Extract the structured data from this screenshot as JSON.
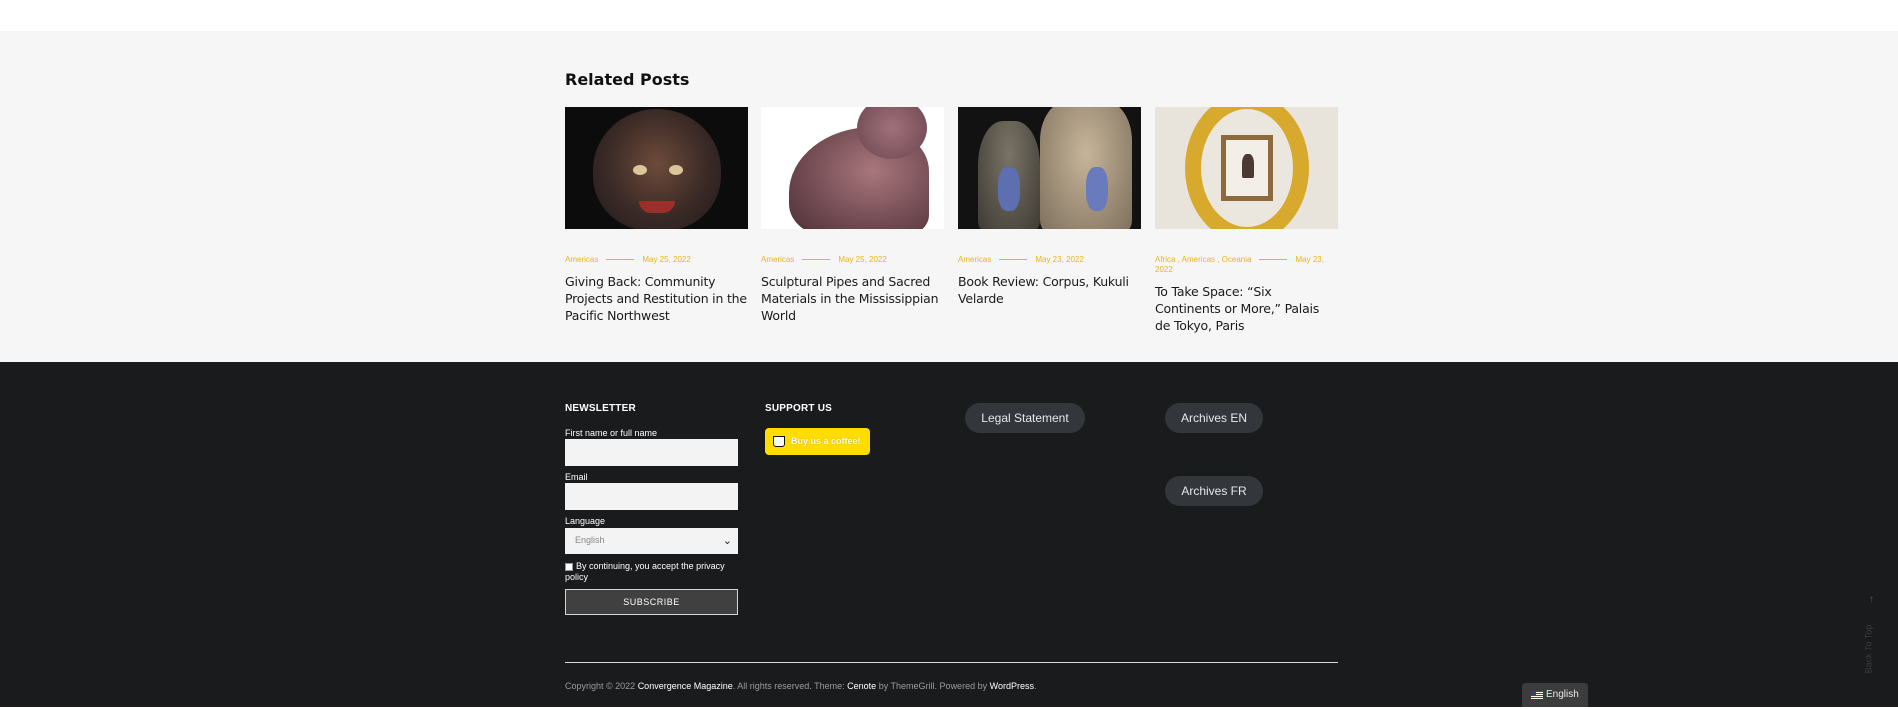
{
  "related": {
    "title": "Related Posts",
    "posts": [
      {
        "meta_categories": "Americas",
        "date": "May 25, 2022",
        "title": "Giving Back: Community Projects and Restitution in the Pacific Northwest",
        "image_icon": "mask-image"
      },
      {
        "meta_categories": "Americas",
        "date": "May 25, 2022",
        "title": "Sculptural Pipes and Sacred Materials in the Mississippian World",
        "image_icon": "sculpture-image"
      },
      {
        "meta_categories": "Americas",
        "date": "May 23, 2022",
        "title": "Book Review: Corpus, Kukuli Velarde",
        "image_icon": "figures-image"
      },
      {
        "meta_categories": "Africa , Americas , Oceania",
        "date": "May 23, 2022",
        "title": "To Take Space: “Six Continents or More,” Palais de Tokyo, Paris",
        "image_icon": "frame-image"
      }
    ]
  },
  "footer": {
    "newsletter": {
      "heading": "NEWSLETTER",
      "name_label": "First name or full name",
      "name_value": "",
      "email_label": "Email",
      "email_value": "",
      "language_label": "Language",
      "language_value": "English",
      "consent_text": "By continuing, you accept the privacy policy",
      "subscribe_label": "SUBSCRIBE"
    },
    "support": {
      "heading": "SUPPORT US",
      "coffee_label": "Buy us a coffee!"
    },
    "links": {
      "legal": "Legal Statement",
      "archives_en": "Archives EN",
      "archives_fr": "Archives FR"
    },
    "copyright": {
      "prefix": "Copyright © 2022",
      "site": "Convergence Magazine",
      "mid": ". All rights reserved. Theme:",
      "theme": "Cenote",
      "by": "by ThemeGrill. Powered by",
      "platform": "WordPress",
      "suffix": "."
    },
    "back_to_top": "Back To Top",
    "language_switcher": "English"
  },
  "colors": {
    "accent": "#e8b423",
    "footer_bg": "#1a1b1d",
    "section_bg": "#f6f6f6",
    "coffee": "#ffdd00"
  }
}
